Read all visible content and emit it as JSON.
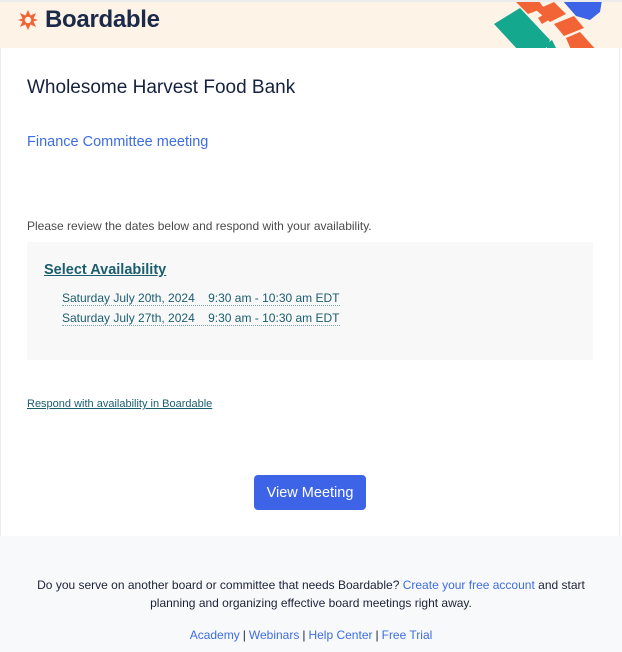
{
  "header": {
    "brand_name": "Boardable",
    "brand_color": "#f26436",
    "logo_icon": "boardable-star-icon",
    "decoration": "geometric-brand-art"
  },
  "main": {
    "organization_name": "Wholesome Harvest Food Bank",
    "meeting_title": "Finance Committee meeting",
    "intro_text": "Please review the dates below and respond with your availability.",
    "availability": {
      "title": "Select Availability",
      "dates": [
        {
          "date": "Saturday July 20th, 2024",
          "time": "9:30 am - 10:30 am EDT"
        },
        {
          "date": "Saturday July 27th, 2024",
          "time": "9:30 am - 10:30 am EDT"
        }
      ]
    },
    "respond_link": "Respond with availability in Boardable",
    "view_meeting_button": "View Meeting"
  },
  "footer": {
    "promo_before": "Do you serve on another board or committee that needs Boardable?",
    "promo_link": "Create your free account",
    "promo_after": "and start planning and organizing effective board meetings right away.",
    "links": [
      "Academy",
      "Webinars",
      "Help Center",
      "Free Trial"
    ],
    "separator": "|"
  },
  "colors": {
    "accent_blue": "#3d63e6",
    "link_teal": "#1a5d6e",
    "header_bg": "#fdf3e6",
    "brand_orange": "#f26436",
    "brand_green": "#14a88e"
  }
}
